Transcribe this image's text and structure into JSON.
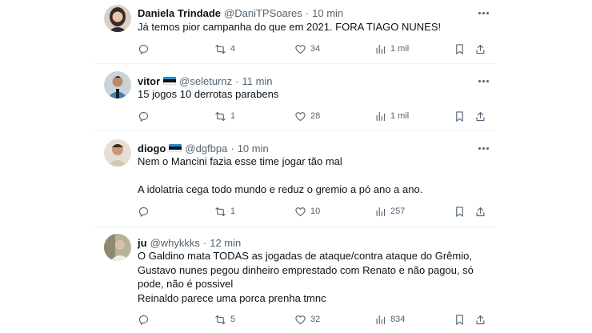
{
  "tweets": [
    {
      "name": "Daniela Trindade",
      "handle": "@DaniTPSoares",
      "dot": "·",
      "time": "10 min",
      "lines": [
        "Já temos pior campanha do que em 2021. FORA TIAGO NUNES!"
      ],
      "retweets": "4",
      "likes": "34",
      "views": "1 mil",
      "avatar_icon": "avatar-woman"
    },
    {
      "name": "vitor",
      "flag_colors": [
        "#1f8fd8",
        "#111111",
        "#ffffff"
      ],
      "handle": "@seleturnz",
      "dot": "·",
      "time": "11 min",
      "lines": [
        "15 jogos 10 derrotas parabens"
      ],
      "retweets": "1",
      "likes": "28",
      "views": "1 mil",
      "avatar_icon": "avatar-player-blue"
    },
    {
      "name": "diogo",
      "flag_colors": [
        "#1f8fd8",
        "#111111",
        "#ffffff"
      ],
      "handle": "@dgfbpa",
      "dot": "·",
      "time": "10 min",
      "lines": [
        "Nem o Mancini fazia esse time jogar tão mal",
        "",
        "A idolatria cega todo mundo e reduz o gremio a pó ano a ano."
      ],
      "retweets": "1",
      "likes": "10",
      "views": "257",
      "avatar_icon": "avatar-man"
    },
    {
      "name": "ju",
      "handle": "@whykkks",
      "dot": "·",
      "time": "12 min",
      "lines": [
        "O Galdino mata TODAS as jogadas de ataque/contra ataque do Grêmio,",
        "Gustavo nunes pegou dinheiro emprestado com Renato e não pagou, só",
        "pode, não é possivel",
        "Reinaldo parece uma porca prenha tmnc"
      ],
      "retweets": "5",
      "likes": "32",
      "views": "834",
      "avatar_icon": "avatar-photo"
    }
  ],
  "colors": {
    "text_primary": "#0f1419",
    "text_secondary": "#536471",
    "divider": "#eff3f4"
  }
}
